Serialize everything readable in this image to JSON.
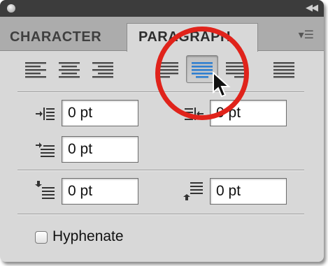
{
  "panel": {
    "tabs": [
      {
        "label": "CHARACTER",
        "active": false
      },
      {
        "label": "PARAGRAPH",
        "active": true
      }
    ]
  },
  "alignment": {
    "buttons": [
      {
        "icon": "align-left-icon"
      },
      {
        "icon": "align-center-icon"
      },
      {
        "icon": "align-right-icon"
      },
      {
        "icon": "justify-last-left-icon"
      },
      {
        "icon": "justify-last-center-icon",
        "active": true
      },
      {
        "icon": "justify-last-right-icon"
      },
      {
        "icon": "justify-all-icon"
      }
    ],
    "highlight_color": "#e0231b"
  },
  "indents": {
    "left_indent": "0 pt",
    "right_indent": "0 pt",
    "first_line_indent": "0 pt"
  },
  "spacing": {
    "space_before": "0 pt",
    "space_after": "0 pt"
  },
  "hyphenate": {
    "label": "Hyphenate",
    "checked": false
  }
}
